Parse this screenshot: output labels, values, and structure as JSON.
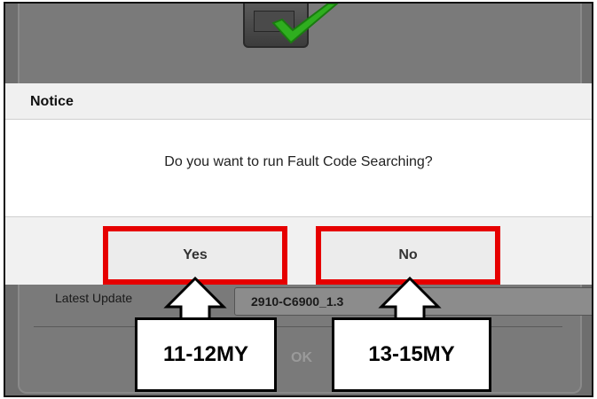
{
  "dialog": {
    "title": "Notice",
    "message": "Do you want to run Fault Code Searching?",
    "buttons": {
      "yes": "Yes",
      "no": "No"
    }
  },
  "background": {
    "latest_update_label": "Latest Update",
    "latest_update_value": "2910-C6900_1.3",
    "ok_label": "OK"
  },
  "callouts": {
    "left": "11-12MY",
    "right": "13-15MY"
  },
  "icons": {
    "device": "device-icon",
    "check": "check-icon",
    "arrow": "arrow-up-icon"
  },
  "colors": {
    "highlight": "#e60000",
    "overlay": "#6e6e6e",
    "check_green": "#2fae1f"
  }
}
